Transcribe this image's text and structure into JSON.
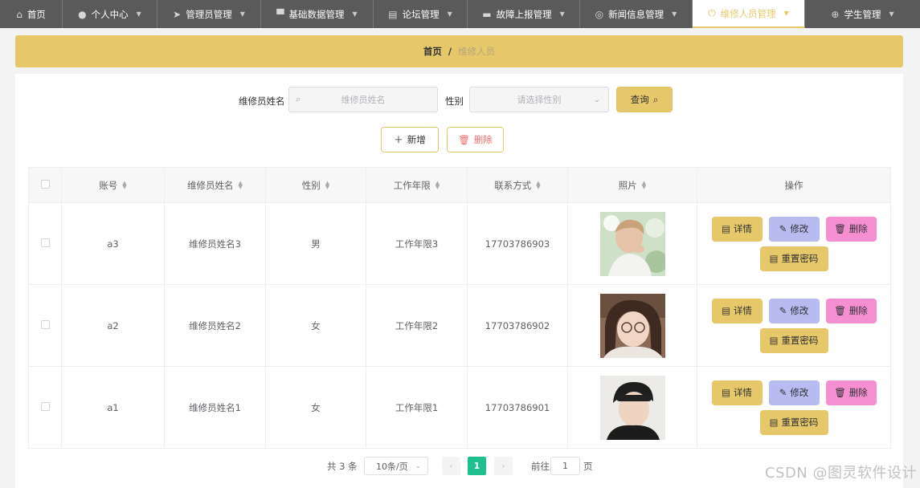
{
  "nav": {
    "items": [
      {
        "label": "首页",
        "icon": "home-icon",
        "glyph": "⌂",
        "active": false
      },
      {
        "label": "个人中心",
        "icon": "user-icon",
        "glyph": "👤",
        "active": false
      },
      {
        "label": "管理员管理",
        "icon": "paper-plane-icon",
        "glyph": "➤",
        "active": false
      },
      {
        "label": "基础数据管理",
        "icon": "monitor-icon",
        "glyph": "▀",
        "active": false
      },
      {
        "label": "论坛管理",
        "icon": "document-icon",
        "glyph": "▤",
        "active": false
      },
      {
        "label": "故障上报管理",
        "icon": "screen-icon",
        "glyph": "▬",
        "active": false
      },
      {
        "label": "新闻信息管理",
        "icon": "globe-icon",
        "glyph": "◎",
        "active": false
      },
      {
        "label": "维修人员管理",
        "icon": "power-icon",
        "glyph": "⏻",
        "active": true
      },
      {
        "label": "学生管理",
        "icon": "crosshair-icon",
        "glyph": "⊕",
        "active": false
      }
    ]
  },
  "breadcrumb": {
    "home": "首页",
    "separator": "/",
    "current": "维修人员"
  },
  "search": {
    "name_label": "维修员姓名",
    "name_placeholder": "维修员姓名",
    "gender_label": "性别",
    "gender_placeholder": "请选择性别",
    "query_label": "查询"
  },
  "actions": {
    "add_label": "新增",
    "delete_label": "删除"
  },
  "table": {
    "columns": [
      "账号",
      "维修员姓名",
      "性别",
      "工作年限",
      "联系方式",
      "照片",
      "操作"
    ],
    "rows": [
      {
        "account": "a3",
        "name": "维修员姓名3",
        "gender": "男",
        "years": "工作年限3",
        "phone": "17703786903"
      },
      {
        "account": "a2",
        "name": "维修员姓名2",
        "gender": "女",
        "years": "工作年限2",
        "phone": "17703786902"
      },
      {
        "account": "a1",
        "name": "维修员姓名1",
        "gender": "女",
        "years": "工作年限1",
        "phone": "17703786901"
      }
    ],
    "ops": {
      "detail": "详情",
      "edit": "修改",
      "delete": "删除",
      "reset": "重置密码"
    }
  },
  "pagination": {
    "total_text": "共 3 条",
    "page_size": "10条/页",
    "current_page": "1",
    "goto_label": "前往",
    "goto_value": "1",
    "page_unit": "页"
  },
  "watermark": "CSDN @图灵软件设计",
  "colors": {
    "accent": "#e6c86a",
    "nav_bg": "#5a5a5a",
    "edit": "#b8bbf0",
    "delete": "#f58fd2",
    "page_active": "#1fbf8f"
  }
}
